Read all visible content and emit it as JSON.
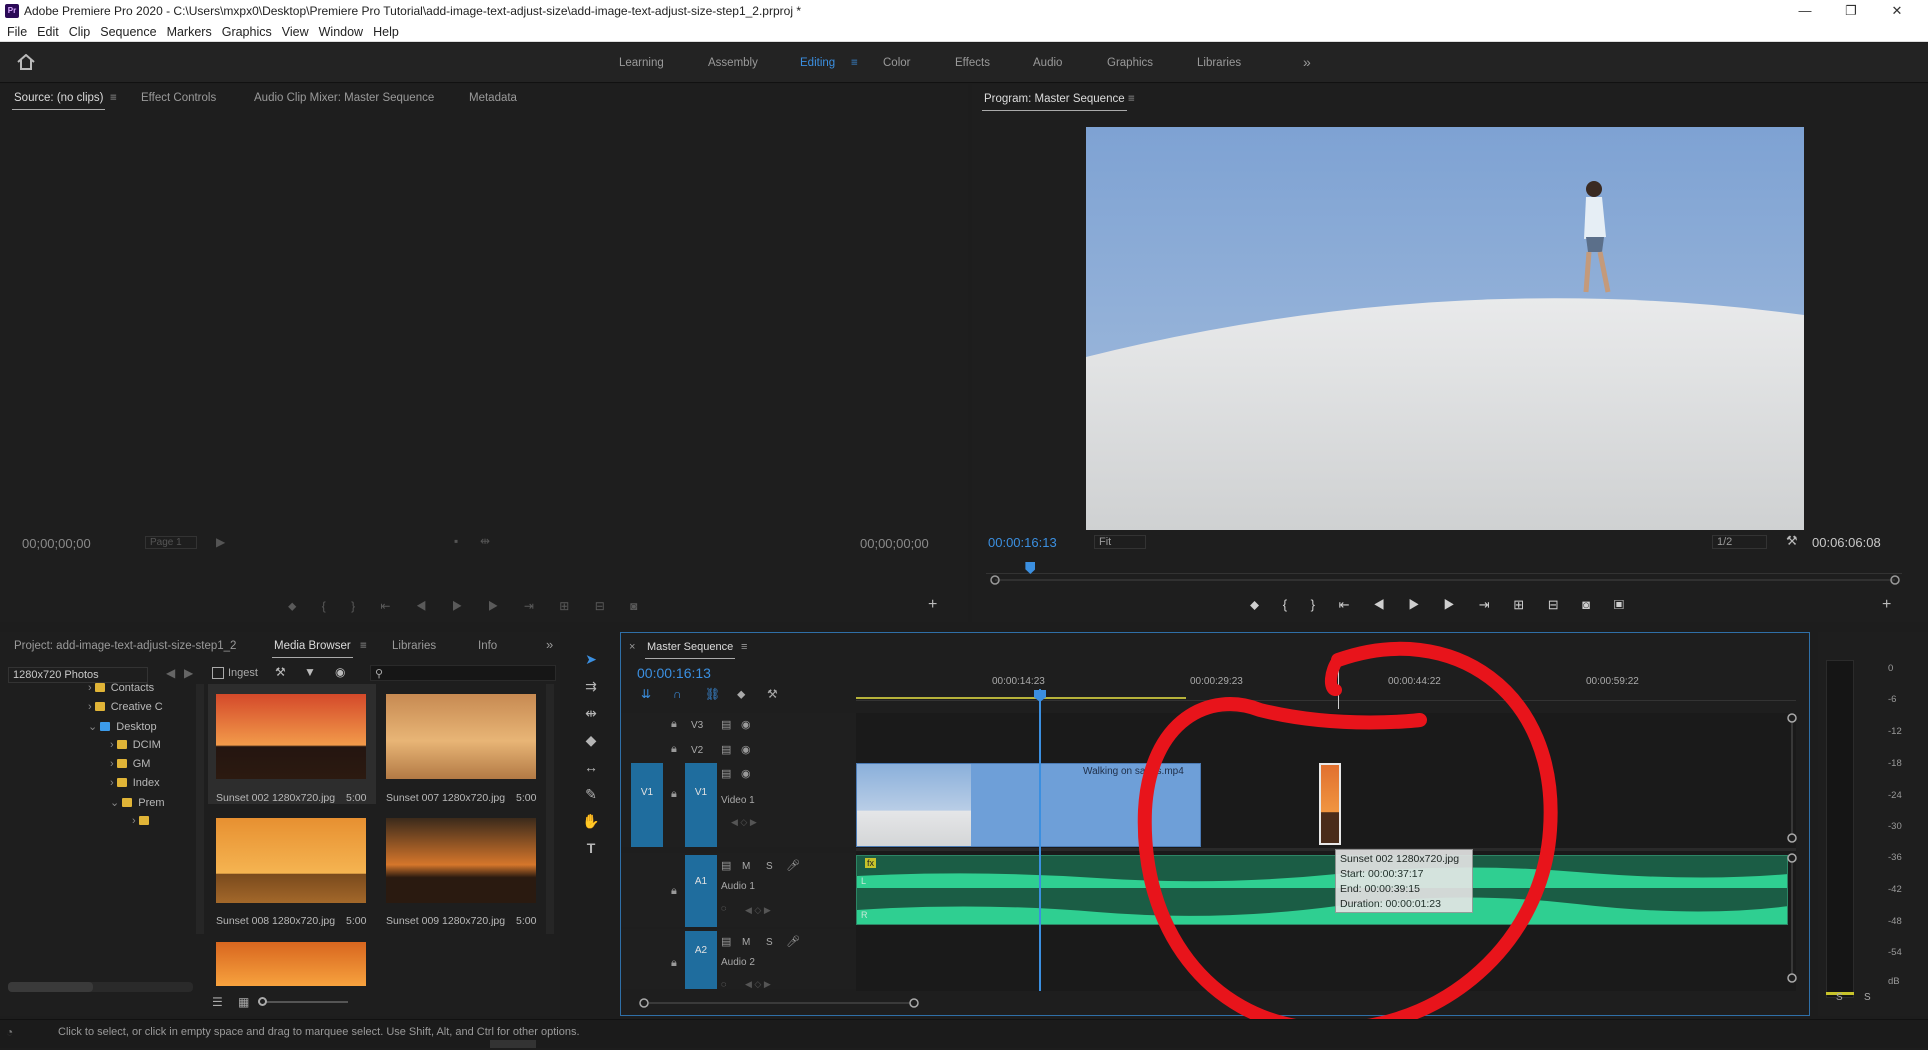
{
  "window": {
    "app_icon": "Pr",
    "title": "Adobe Premiere Pro 2020 - C:\\Users\\mxpx0\\Desktop\\Premiere Pro Tutorial\\add-image-text-adjust-size\\add-image-text-adjust-size-step1_2.prproj *",
    "minimize": "—",
    "maximize": "❐",
    "close": "✕"
  },
  "menu": [
    "File",
    "Edit",
    "Clip",
    "Sequence",
    "Markers",
    "Graphics",
    "View",
    "Window",
    "Help"
  ],
  "workspaces": {
    "items": [
      "Learning",
      "Assembly",
      "Editing",
      "Color",
      "Effects",
      "Audio",
      "Graphics",
      "Libraries"
    ],
    "active": "Editing",
    "more": "»"
  },
  "source_panel": {
    "tabs": [
      "Source: (no clips)",
      "Effect Controls",
      "Audio Clip Mixer: Master Sequence",
      "Metadata"
    ],
    "timecode_in": "00;00;00;00",
    "timecode_out": "00;00;00;00",
    "page": "Page 1"
  },
  "program_panel": {
    "title": "Program: Master Sequence",
    "timecode": "00:00:16:13",
    "fit": "Fit",
    "resolution": "1/2",
    "duration": "00:06:06:08",
    "playhead_fraction": 0.043
  },
  "project_panel": {
    "tabs": [
      "Project: add-image-text-adjust-size-step1_2",
      "Media Browser",
      "Libraries",
      "Info"
    ],
    "active": "Media Browser",
    "dropdown": "1280x720 Photos",
    "ingest": "Ingest",
    "tree": [
      {
        "label": "Contacts",
        "indent": 1
      },
      {
        "label": "Creative C",
        "indent": 1
      },
      {
        "label": "Desktop",
        "indent": 1,
        "open": true,
        "color": "blue"
      },
      {
        "label": "DCIM",
        "indent": 2
      },
      {
        "label": "GM",
        "indent": 2
      },
      {
        "label": "Index",
        "indent": 2
      },
      {
        "label": "Prem",
        "indent": 2,
        "open": true
      },
      {
        "label": "",
        "indent": 3
      }
    ],
    "thumbnails": [
      {
        "label": "Sunset 002 1280x720.jpg",
        "duration": "5:00"
      },
      {
        "label": "Sunset 007 1280x720.jpg",
        "duration": "5:00"
      },
      {
        "label": "Sunset 008 1280x720.jpg",
        "duration": "5:00"
      },
      {
        "label": "Sunset 009 1280x720.jpg",
        "duration": "5:00"
      }
    ]
  },
  "timeline": {
    "tab": "Master Sequence",
    "timecode": "00:00:16:13",
    "ruler": [
      "00:00:14:23",
      "00:00:29:23",
      "00:00:44:22",
      "00:00:59:22"
    ],
    "tracks": [
      {
        "id": "V3",
        "name": ""
      },
      {
        "id": "V2",
        "name": ""
      },
      {
        "id": "V1",
        "name": "Video 1",
        "source": "V1"
      },
      {
        "id": "A1",
        "name": "Audio 1"
      },
      {
        "id": "A2",
        "name": "Audio 2"
      }
    ],
    "clip_video": "Walking on sands.mp4",
    "clip_image": "Sunset 002 1280x720.jpg",
    "tooltip": {
      "name": "Sunset 002 1280x720.jpg",
      "start": "Start: 00:00:37:17",
      "end": "End: 00:00:39:15",
      "duration": "Duration: 00:00:01:23"
    },
    "track_mute": "M",
    "track_solo": "S",
    "audio_left": "L",
    "audio_right": "R",
    "fx": "fx"
  },
  "meters": {
    "labels": [
      "0",
      "-6",
      "-12",
      "-18",
      "-24",
      "-30",
      "-36",
      "-42",
      "-48",
      "-54",
      "dB"
    ],
    "solo": [
      "S",
      "S"
    ]
  },
  "status": {
    "text": "Click to select, or click in empty space and drag to marquee select. Use Shift, Alt, and Ctrl for other options."
  },
  "colors": {
    "accent": "#3b8fe0",
    "track_blue": "#1f6d9e",
    "audio_green": "#2fcf91",
    "annotation_red": "#e8141b"
  }
}
